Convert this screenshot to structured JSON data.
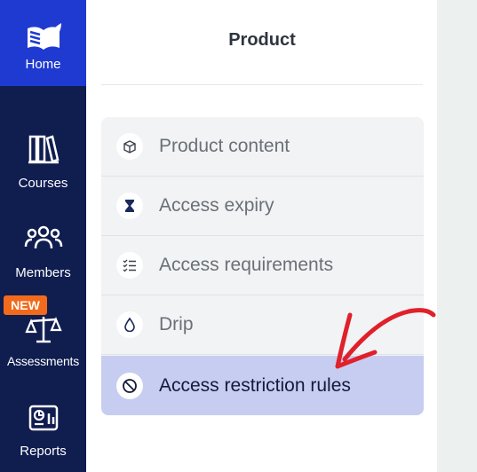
{
  "sidebar": {
    "home": {
      "label": "Home",
      "icon": "book-leaf-icon"
    },
    "items": [
      {
        "label": "Courses",
        "icon": "books-icon"
      },
      {
        "label": "Members",
        "icon": "people-icon"
      },
      {
        "label": "Assessments",
        "icon": "scales-icon",
        "badge": "NEW"
      },
      {
        "label": "Reports",
        "icon": "report-chart-icon"
      }
    ],
    "colors": {
      "background": "#0f1d4f",
      "active": "#1f3ad0",
      "badge": "#f26a1b"
    }
  },
  "panel": {
    "title": "Product",
    "menu": [
      {
        "label": "Product content",
        "icon": "box-icon"
      },
      {
        "label": "Access expiry",
        "icon": "hourglass-icon"
      },
      {
        "label": "Access requirements",
        "icon": "checklist-icon"
      },
      {
        "label": "Drip",
        "icon": "droplet-icon"
      },
      {
        "label": "Access restriction rules",
        "icon": "prohibited-icon",
        "active": true
      }
    ],
    "colors": {
      "menu_bg": "#f1f3f4",
      "active_bg": "#c7cdf0"
    }
  },
  "annotation": {
    "color": "#e0202a",
    "icon": "hand-drawn-arrow"
  }
}
